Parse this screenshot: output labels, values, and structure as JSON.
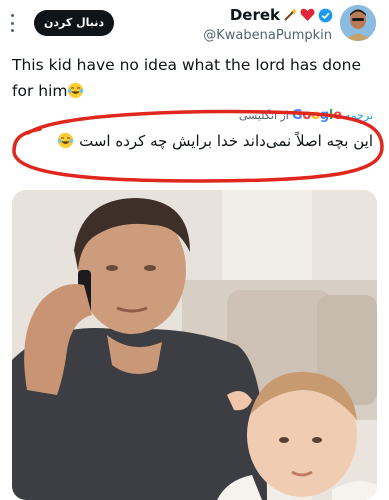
{
  "header": {
    "display_name": "Derek",
    "handle": "@KwabenaPumpkin",
    "follow_label": "دنبال کردن"
  },
  "tweet": {
    "text": "This kid have no idea what the lord has done for him",
    "emoji": "laughing-tears-emoji"
  },
  "translation": {
    "label_prefix": "ترجمه",
    "google": "Google",
    "label_suffix": "از انگلیسی",
    "text": "این بچه اصلاً نمی‌داند خدا برایش چه کرده است"
  },
  "colors": {
    "accent": "#1d9bf0",
    "annotation": "#e0271d",
    "verified": "#1d9bf0"
  },
  "icons": [
    "wand-icon",
    "heart-icon",
    "verified-badge-icon",
    "more-options-icon",
    "avatar"
  ],
  "photo": {
    "description_icon": "photo-man-on-phone-with-baby"
  }
}
